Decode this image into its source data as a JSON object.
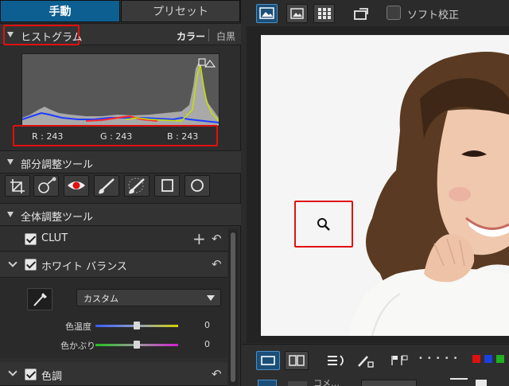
{
  "tabs": {
    "manual": "手動",
    "preset": "プリセット"
  },
  "histogram": {
    "title": "ヒストグラム",
    "mode_color": "カラー",
    "mode_mono": "白黒",
    "readout": {
      "r": "R : 243",
      "g": "G : 243",
      "b": "B : 243"
    }
  },
  "local_tools": {
    "title": "部分調整ツール"
  },
  "global_tools": {
    "title": "全体調整ツール",
    "clut": {
      "label": "CLUT"
    },
    "white_balance": {
      "label": "ホワイト バランス",
      "preset_value": "カスタム",
      "temperature_label": "色温度",
      "temperature_value": "0",
      "tint_label": "色かぶり",
      "tint_value": "0"
    },
    "tone": {
      "label": "色調"
    }
  },
  "top_toolbar": {
    "soft_proof_label": "ソフト校正"
  },
  "bottom_toolbar": {
    "partial_label": "コメ…"
  },
  "colors": {
    "accent": "#0d5f91",
    "highlight_red": "#e01010"
  }
}
